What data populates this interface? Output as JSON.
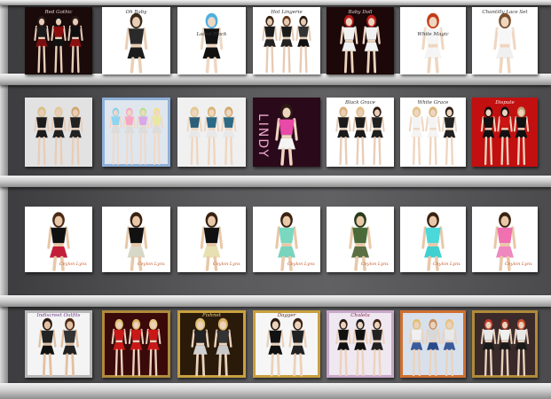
{
  "shelves": [
    {
      "posters": [
        {
          "name": "red-gothic",
          "caption": "Red Gothic",
          "bg": "#1a0a0a",
          "cap_color": "#e6d0d0",
          "cap_pos": "top",
          "figs": [
            {
              "skin": "#e8cdb8",
              "hair": "#2a1a1a",
              "top": "#1a1a1a",
              "bot": "#7a0f10"
            },
            {
              "skin": "#e8cdb8",
              "hair": "#101010",
              "top": "#8a0c0c",
              "bot": "#111"
            },
            {
              "skin": "#e8cdb8",
              "hair": "#2a1a1a",
              "top": "#0e0e0e",
              "bot": "#8b1010"
            }
          ]
        },
        {
          "name": "oh-baby",
          "caption": "Oh Baby",
          "bg": "#ffffff",
          "cap_color": "#333",
          "cap_pos": "top",
          "figs": [
            {
              "skin": "#e9cfb5",
              "hair": "#3a2a1a",
              "top": "#2a2a2a",
              "bot": "#1d1d1d"
            }
          ]
        },
        {
          "name": "laced-black",
          "caption": "Laced Black",
          "bg": "#ffffff",
          "cap_color": "#333",
          "cap_pos": "mid",
          "figs": [
            {
              "skin": "#efd7c3",
              "hair": "#4fb0e0",
              "top": "#111",
              "bot": "#111"
            }
          ]
        },
        {
          "name": "hot-lingerie",
          "caption": "Hot Lingerie",
          "bg": "#ffffff",
          "cap_color": "#333",
          "cap_pos": "top",
          "figs": [
            {
              "skin": "#e7cbb3",
              "hair": "#3a2414",
              "top": "#1b1b1b",
              "bot": "#222"
            },
            {
              "skin": "#e7cbb3",
              "hair": "#6a3a1e",
              "top": "#1b1b1b",
              "bot": "#222"
            },
            {
              "skin": "#e7cbb3",
              "hair": "#2a1a12",
              "top": "#333",
              "bot": "#111"
            }
          ]
        },
        {
          "name": "baby-doll",
          "caption": "Baby Doll",
          "bg": "#1c0808",
          "cap_color": "#e6d0d0",
          "cap_pos": "top",
          "figs": [
            {
              "skin": "#ebd3be",
              "hair": "#b31818",
              "top": "#f1f1f1",
              "bot": "#f1f1f1"
            },
            {
              "skin": "#ebd3be",
              "hair": "#c21c1c",
              "top": "#f1f1f1",
              "bot": "#f3f3f3"
            }
          ]
        },
        {
          "name": "white-magic",
          "caption": "White Magic",
          "bg": "#ffffff",
          "cap_color": "#333",
          "cap_pos": "mid",
          "figs": [
            {
              "skin": "#efd6c0",
              "hair": "#c43c18",
              "top": "#f5f5f5",
              "bot": "#f5f5f5"
            }
          ]
        },
        {
          "name": "chantilly-lace-set",
          "caption": "Chantilly Lace Set",
          "bg": "#ffffff",
          "cap_color": "#333",
          "cap_pos": "top",
          "figs": [
            {
              "skin": "#efd6c0",
              "hair": "#7a5030",
              "top": "#f7f7f7",
              "bot": "#f0f0f0"
            }
          ]
        }
      ]
    },
    {
      "posters": [
        {
          "name": "leather-suits",
          "caption": "",
          "bg": "#e2e2e2",
          "cap_color": "#333",
          "cap_pos": "top",
          "figs": [
            {
              "skin": "#e8cdb8",
              "hair": "#d8c08a",
              "top": "#1b1b1b",
              "bot": "#1b1b1b"
            },
            {
              "skin": "#e8cdb8",
              "hair": "#e1c99a",
              "top": "#202020",
              "bot": "#202020"
            },
            {
              "skin": "#e8cdb8",
              "hair": "#cfa770",
              "top": "#222",
              "bot": "#222"
            }
          ]
        },
        {
          "name": "colored-cardigans",
          "caption": "",
          "bg": "#dfe6ee",
          "cap_color": "#333",
          "cap_pos": "top",
          "border": "#8fb0d8",
          "figs": [
            {
              "skin": "#f0d8c6",
              "hair": "#8fd0e8",
              "top": "#8fd4f0",
              "bot": "#dcdcdc"
            },
            {
              "skin": "#f0d8c6",
              "hair": "#f4a8c4",
              "top": "#f4a8c4",
              "bot": "#dcdcdc"
            },
            {
              "skin": "#f0d8c6",
              "hair": "#b8e08a",
              "top": "#d8a8e8",
              "bot": "#dcdcdc"
            },
            {
              "skin": "#f0d8c6",
              "hair": "#f2e08a",
              "top": "#e8e8a0",
              "bot": "#dcdcdc"
            }
          ]
        },
        {
          "name": "denim-corsets",
          "caption": "",
          "bg": "#f0f0f0",
          "cap_color": "#333",
          "cap_pos": "top",
          "figs": [
            {
              "skin": "#efd6c0",
              "hair": "#e2c890",
              "top": "#2f5f78",
              "bot": "#e8e8e8"
            },
            {
              "skin": "#efd6c0",
              "hair": "#d8b478",
              "top": "#2a6a88",
              "bot": "#e8e8e8"
            },
            {
              "skin": "#efd6c0",
              "hair": "#d4a86c",
              "top": "#2f6a84",
              "bot": "#e8e8e8"
            }
          ]
        },
        {
          "name": "lindy",
          "caption": "LINDY",
          "bg": "#2a0a1a",
          "cap_color": "#f0a8d0",
          "cap_pos": "top",
          "vertical": true,
          "figs": [
            {
              "skin": "#efd6c0",
              "hair": "#2a1a12",
              "top": "#e84aa8",
              "bot": "#f4f4f4"
            }
          ]
        },
        {
          "name": "black-grace",
          "caption": "Black Grace",
          "bg": "#ffffff",
          "cap_color": "#333",
          "cap_pos": "top",
          "figs": [
            {
              "skin": "#e8cdb8",
              "hair": "#d7b07a",
              "top": "#1b1b1b",
              "bot": "#1b1b1b"
            },
            {
              "skin": "#e8cdb8",
              "hair": "#e0c08a",
              "top": "#1b1b1b",
              "bot": "#1b1b1b"
            },
            {
              "skin": "#e8cdb8",
              "hair": "#2a1a12",
              "top": "#202020",
              "bot": "#202020"
            }
          ]
        },
        {
          "name": "white-grace",
          "caption": "White Grace",
          "bg": "#ffffff",
          "cap_color": "#333",
          "cap_pos": "top",
          "figs": [
            {
              "skin": "#efd6c0",
              "hair": "#e2c28a",
              "top": "#f4f4f4",
              "bot": "#f4f4f4"
            },
            {
              "skin": "#efd6c0",
              "hair": "#d8b478",
              "top": "#f4f4f4",
              "bot": "#f4f4f4"
            },
            {
              "skin": "#efd6c0",
              "hair": "#2a1a12",
              "top": "#222",
              "bot": "#222"
            }
          ]
        },
        {
          "name": "dispute",
          "caption": "Dispute",
          "bg": "#c21010",
          "cap_color": "#ffe8e8",
          "cap_pos": "top",
          "figs": [
            {
              "skin": "#ebd2bc",
              "hair": "#1a0a0a",
              "top": "#111",
              "bot": "#111"
            },
            {
              "skin": "#ebd2bc",
              "hair": "#101010",
              "top": "#cc1414",
              "bot": "#111"
            },
            {
              "skin": "#ebd2bc",
              "hair": "#c0a070",
              "top": "#111",
              "bot": "#111"
            }
          ]
        }
      ]
    },
    {
      "posters": [
        {
          "name": "black-top-red-skirt",
          "caption": "",
          "bg": "#ffffff",
          "cap_color": "#333",
          "cap_pos": "top",
          "sig": "Ceylon Lynx",
          "figs": [
            {
              "skin": "#e8c8a8",
              "hair": "#4a2a16",
              "top": "#111",
              "bot": "#c21e3a"
            }
          ]
        },
        {
          "name": "black-top-white-skirt",
          "caption": "",
          "bg": "#ffffff",
          "cap_color": "#333",
          "cap_pos": "top",
          "sig": "Ceylon Lynx",
          "figs": [
            {
              "skin": "#e8c8a8",
              "hair": "#3a2212",
              "top": "#111",
              "bot": "#d8d8c8"
            }
          ]
        },
        {
          "name": "black-top-floral-skirt",
          "caption": "",
          "bg": "#ffffff",
          "cap_color": "#333",
          "cap_pos": "top",
          "sig": "Ceylon Lynx",
          "figs": [
            {
              "skin": "#e8c8a8",
              "hair": "#3a2212",
              "top": "#111",
              "bot": "#e8e0b0"
            }
          ]
        },
        {
          "name": "teal-dress",
          "caption": "",
          "bg": "#ffffff",
          "cap_color": "#333",
          "cap_pos": "top",
          "sig": "Ceylon Lynx",
          "figs": [
            {
              "skin": "#e8c8a8",
              "hair": "#3a2212",
              "top": "#7ad8c0",
              "bot": "#78d4bc"
            }
          ]
        },
        {
          "name": "camo-outfit",
          "caption": "",
          "bg": "#ffffff",
          "cap_color": "#333",
          "cap_pos": "top",
          "sig": "Ceylon Lynx",
          "figs": [
            {
              "skin": "#e8c8a8",
              "hair": "#2a3a1a",
              "top": "#4a6a3a",
              "bot": "#5a7044"
            }
          ]
        },
        {
          "name": "turquoise-dress",
          "caption": "",
          "bg": "#ffffff",
          "cap_color": "#333",
          "cap_pos": "top",
          "sig": "Ceylon Lynx",
          "figs": [
            {
              "skin": "#e8c8a8",
              "hair": "#3a2212",
              "top": "#4ad8d8",
              "bot": "#40d0d0"
            }
          ]
        },
        {
          "name": "pink-corset-dress",
          "caption": "",
          "bg": "#ffffff",
          "cap_color": "#333",
          "cap_pos": "top",
          "sig": "Ceylon Lynx",
          "figs": [
            {
              "skin": "#e8c8a8",
              "hair": "#3a2212",
              "top": "#f070b0",
              "bot": "#f088c0"
            }
          ]
        }
      ]
    },
    {
      "posters": [
        {
          "name": "indiscreet-outfits",
          "caption": "Indiscreet Outfits",
          "bg": "#f4f4f4",
          "cap_color": "#6a3a8a",
          "cap_pos": "top",
          "border": "#b8b8b8",
          "figs": [
            {
              "skin": "#e2c0a2",
              "hair": "#2a1a12",
              "top": "#222",
              "bot": "#111"
            },
            {
              "skin": "#e2c0a2",
              "hair": "#4a2a16",
              "top": "#333",
              "bot": "#222"
            }
          ]
        },
        {
          "name": "red-gold-outfits",
          "caption": "",
          "bg": "#3a0a0a",
          "cap_color": "#f0d080",
          "cap_pos": "top",
          "border": "#b08a3a",
          "figs": [
            {
              "skin": "#ebd2bc",
              "hair": "#e0c070",
              "top": "#c81818",
              "bot": "#c81818"
            },
            {
              "skin": "#ebd2bc",
              "hair": "#d8b060",
              "top": "#c81818",
              "bot": "#c81818"
            },
            {
              "skin": "#ebd2bc",
              "hair": "#e8c880",
              "top": "#c81818",
              "bot": "#c81818"
            }
          ]
        },
        {
          "name": "fishnet-outfits",
          "caption": "Fishnet",
          "bg": "#2a1a0a",
          "cap_color": "#f0d080",
          "cap_pos": "top",
          "border": "#c8a040",
          "figs": [
            {
              "skin": "#ebd2bc",
              "hair": "#e0c070",
              "top": "#222",
              "bot": "#d0d0d0"
            },
            {
              "skin": "#ebd2bc",
              "hair": "#d8b060",
              "top": "#333",
              "bot": "#c8c8c8"
            }
          ]
        },
        {
          "name": "dagger-outfits",
          "caption": "Dagger",
          "bg": "#f6f6f6",
          "cap_color": "#5a2a2a",
          "cap_pos": "top",
          "border": "#c8a040",
          "figs": [
            {
              "skin": "#ebd2bc",
              "hair": "#2a1a12",
              "top": "#111",
              "bot": "#111"
            },
            {
              "skin": "#ebd2bc",
              "hair": "#3a2212",
              "top": "#222",
              "bot": "#222"
            }
          ]
        },
        {
          "name": "chaleta-outfits",
          "caption": "Chaleta",
          "bg": "#f0e8f0",
          "cap_color": "#7a1a4a",
          "cap_pos": "top",
          "border": "#c8a8c8",
          "figs": [
            {
              "skin": "#ebd2bc",
              "hair": "#2a1a12",
              "top": "#111",
              "bot": "#111"
            },
            {
              "skin": "#ebd2bc",
              "hair": "#1a1a1a",
              "top": "#111",
              "bot": "#111"
            },
            {
              "skin": "#ebd2bc",
              "hair": "#3a2212",
              "top": "#222",
              "bot": "#222"
            }
          ]
        },
        {
          "name": "blue-outfits",
          "caption": "",
          "bg": "#d8e0ec",
          "cap_color": "#2a3a6a",
          "cap_pos": "top",
          "border": "#d07030",
          "figs": [
            {
              "skin": "#ebd2bc",
              "hair": "#e0c070",
              "top": "#f0f0f0",
              "bot": "#3a5a9a"
            },
            {
              "skin": "#ebd2bc",
              "hair": "#c89060",
              "top": "#d8d8d8",
              "bot": "#2a4a8a"
            },
            {
              "skin": "#ebd2bc",
              "hair": "#e8c080",
              "top": "#e8e8e8",
              "bot": "#3a5a9a"
            }
          ]
        },
        {
          "name": "dark-pants-outfits",
          "caption": "",
          "bg": "#3a2a2a",
          "cap_color": "#e8d0b0",
          "cap_pos": "top",
          "border": "#b08a3a",
          "figs": [
            {
              "skin": "#ebd2bc",
              "hair": "#c83a2a",
              "top": "#e8e8e8",
              "bot": "#1a1a1a"
            },
            {
              "skin": "#ebd2bc",
              "hair": "#a0301e",
              "top": "#f0f0f0",
              "bot": "#1a1a1a"
            },
            {
              "skin": "#ebd2bc",
              "hair": "#d05030",
              "top": "#e8e8e8",
              "bot": "#1a1a1a"
            }
          ]
        }
      ]
    }
  ]
}
